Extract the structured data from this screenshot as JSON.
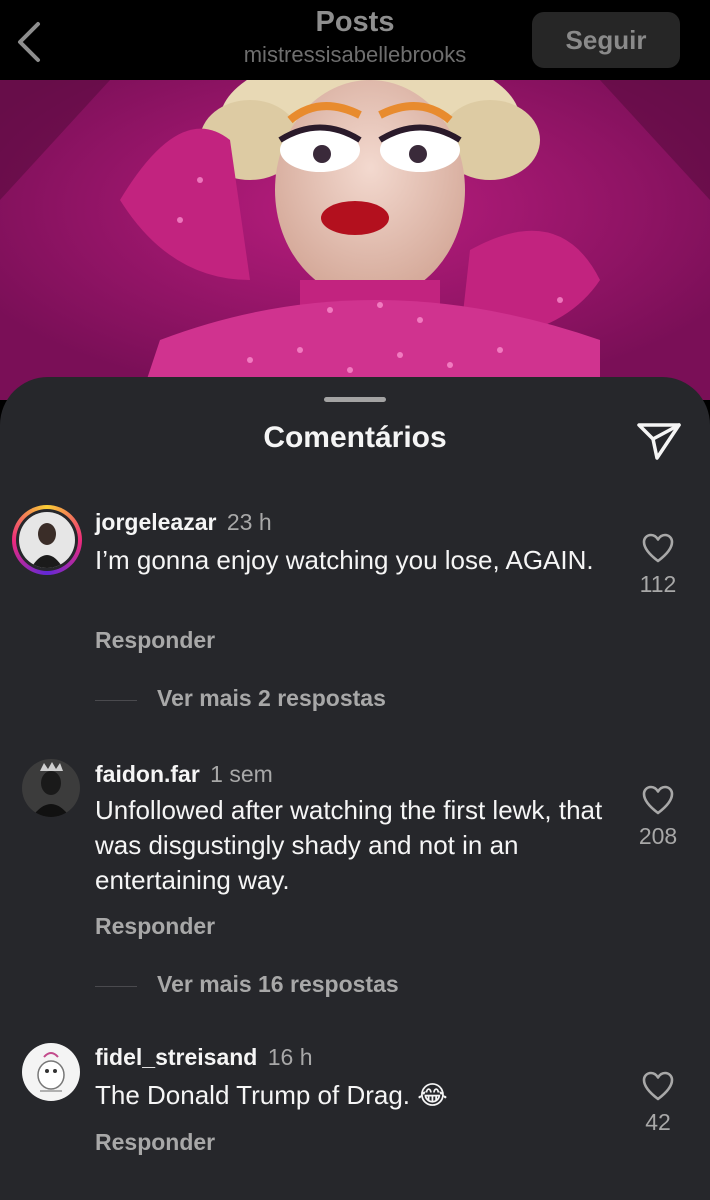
{
  "header": {
    "title": "Posts",
    "username": "mistressisabellebrooks",
    "follow_label": "Seguir"
  },
  "sheet": {
    "title": "Comentários"
  },
  "comments": [
    {
      "username": "jorgeleazar",
      "time": "23 h",
      "text": "I’m gonna enjoy watching you lose, AGAIN.",
      "likes": "112",
      "reply_label": "Responder",
      "more_replies": "Ver mais 2 respostas"
    },
    {
      "username": "faidon.far",
      "time": "1 sem",
      "text": "Unfollowed after watching the first lewk, that was disgustingly shady and not in an entertaining way.",
      "likes": "208",
      "reply_label": "Responder",
      "more_replies": "Ver mais 16 respostas"
    },
    {
      "username": "fidel_streisand",
      "time": "16 h",
      "text": "The Donald Trump of Drag. 😂",
      "likes": "42",
      "reply_label": "Responder"
    }
  ],
  "colors": {
    "sheet_bg": "#26272b",
    "post_accent": "#8d1668"
  },
  "icons": [
    "back-chevron-icon",
    "share-send-icon",
    "heart-icon"
  ]
}
